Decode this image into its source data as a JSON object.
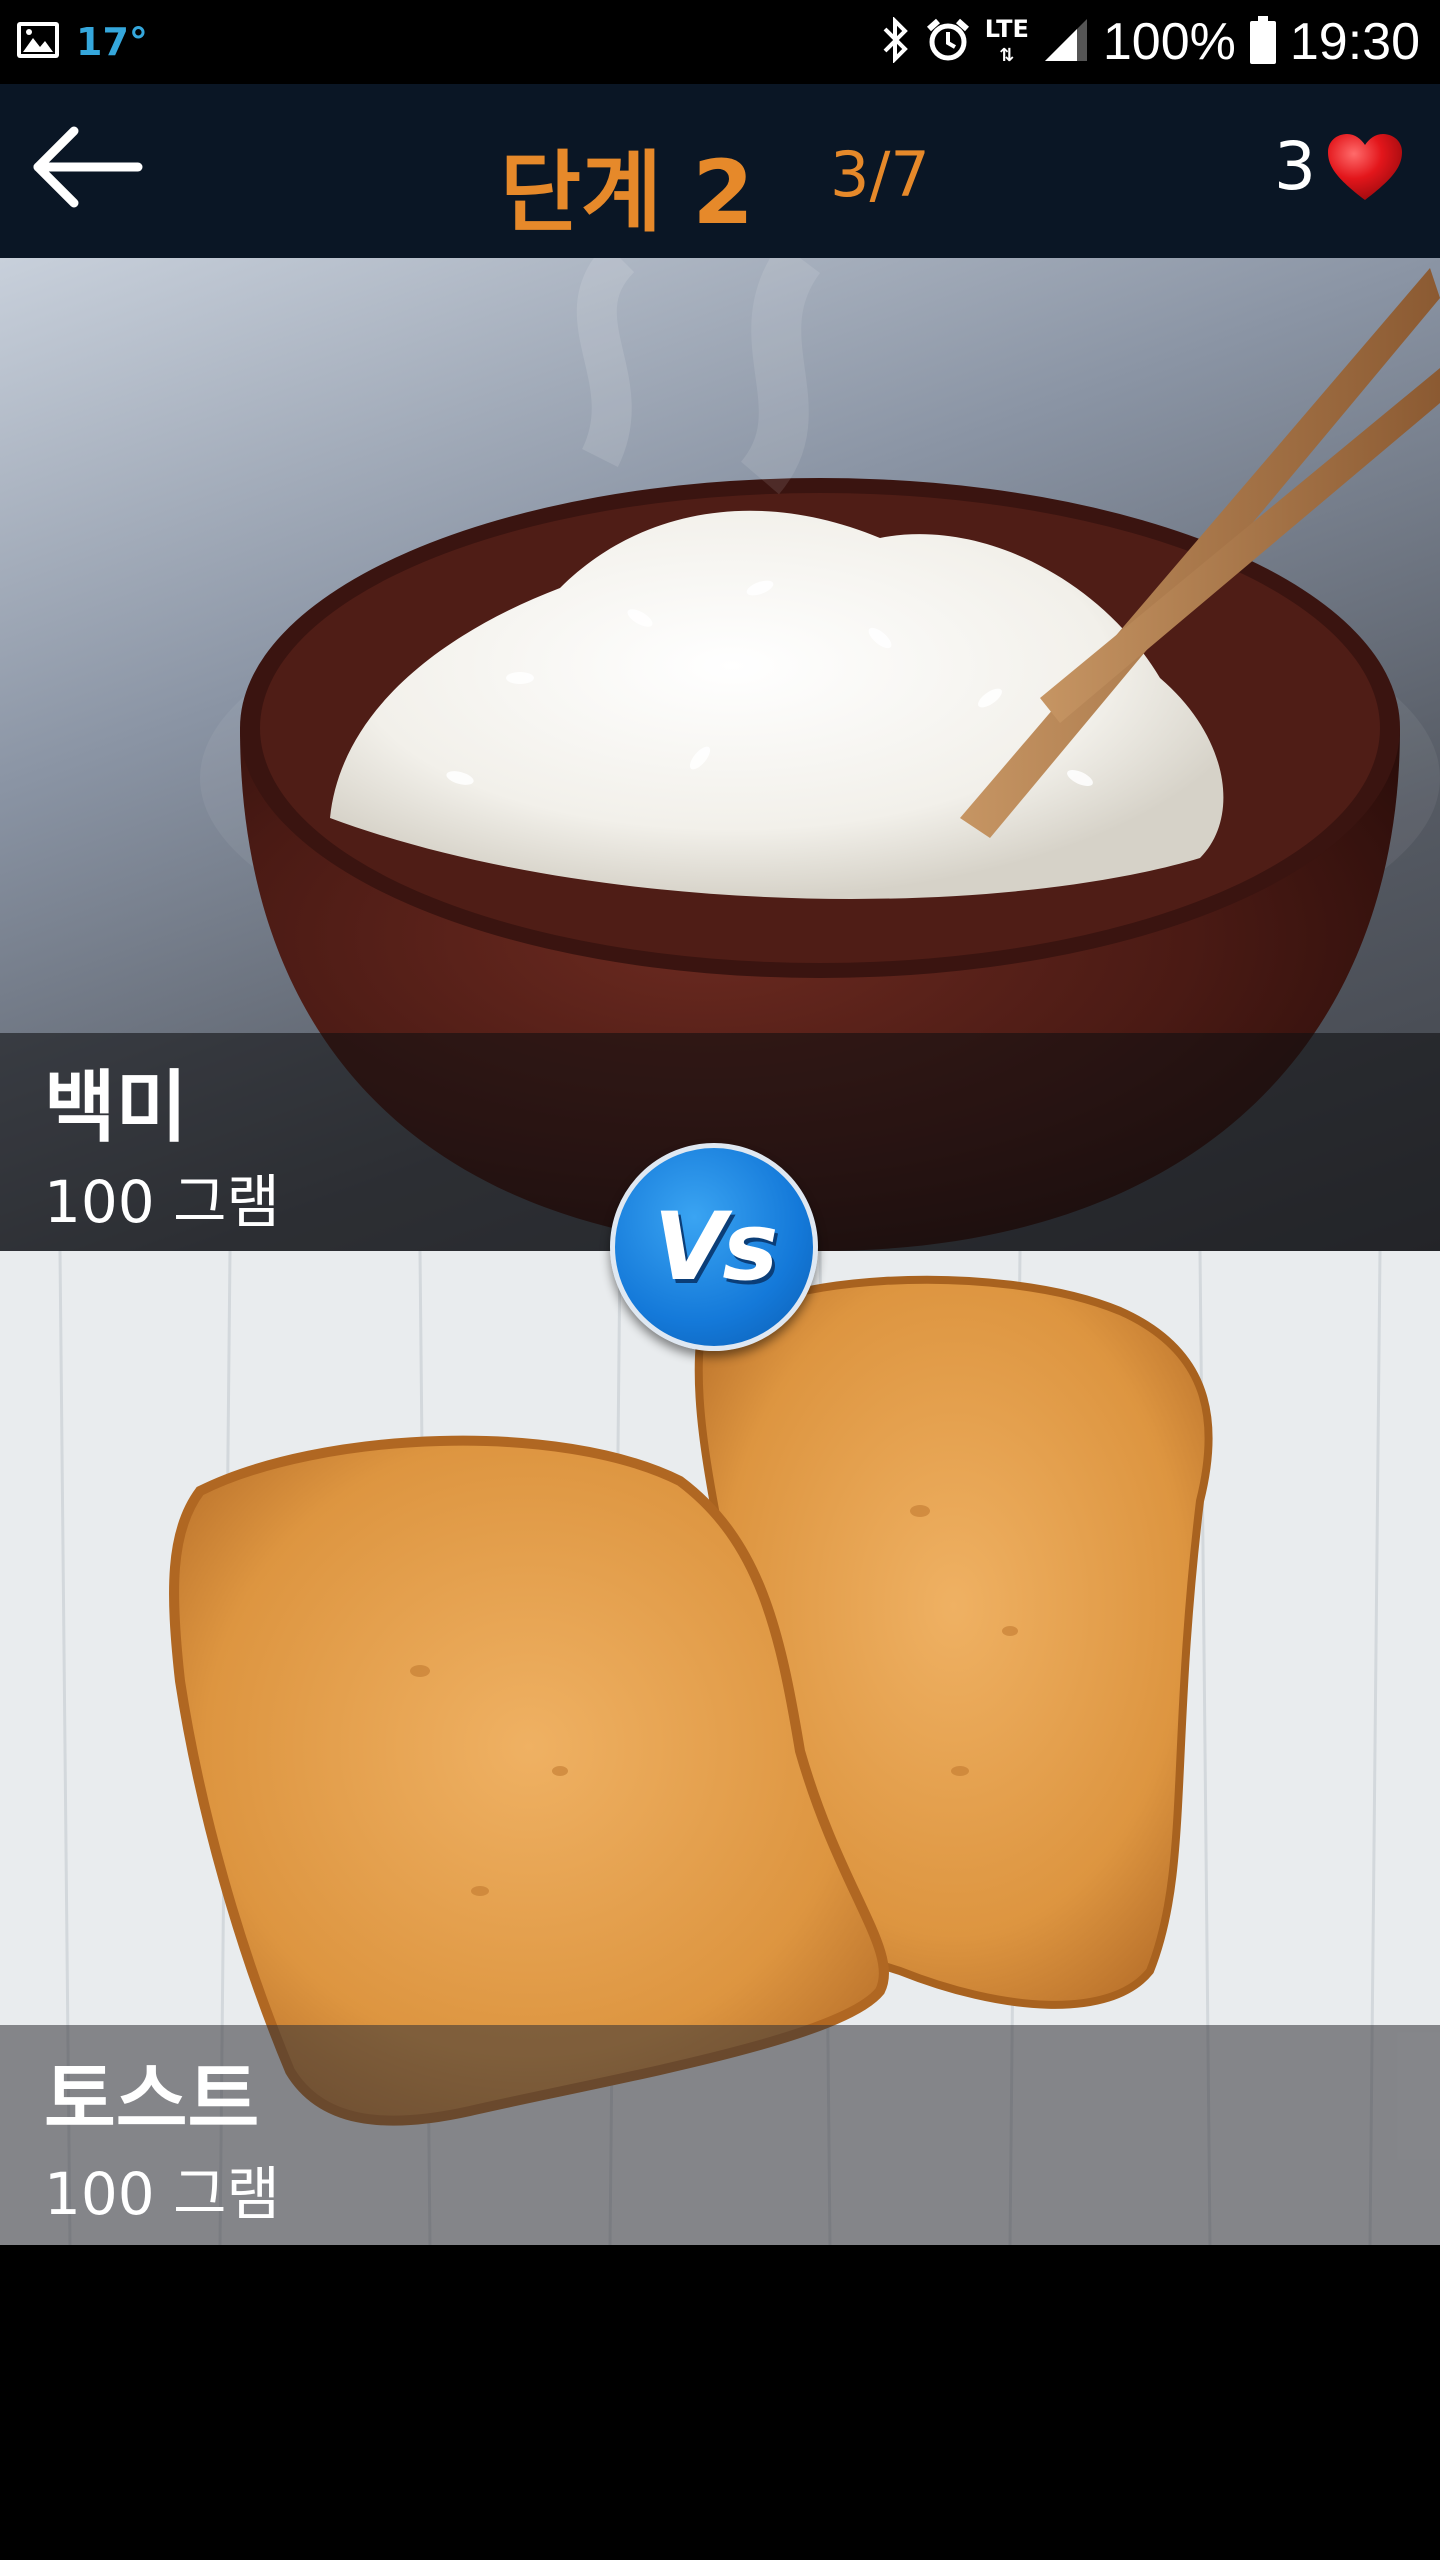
{
  "status_bar": {
    "temperature": "17°",
    "network": "LTE",
    "battery": "100%",
    "time": "19:30"
  },
  "header": {
    "level": "단계 2",
    "progress": "3/7",
    "lives": "3"
  },
  "options": [
    {
      "name": "백미",
      "amount": "100 그램"
    },
    {
      "name": "토스트",
      "amount": "100 그램"
    }
  ],
  "vs_label": "Vs",
  "colors": {
    "accent": "#e6892a",
    "header_bg": "#0a1625",
    "vs_blue": "#1479d9",
    "heart": "#e3161b"
  }
}
